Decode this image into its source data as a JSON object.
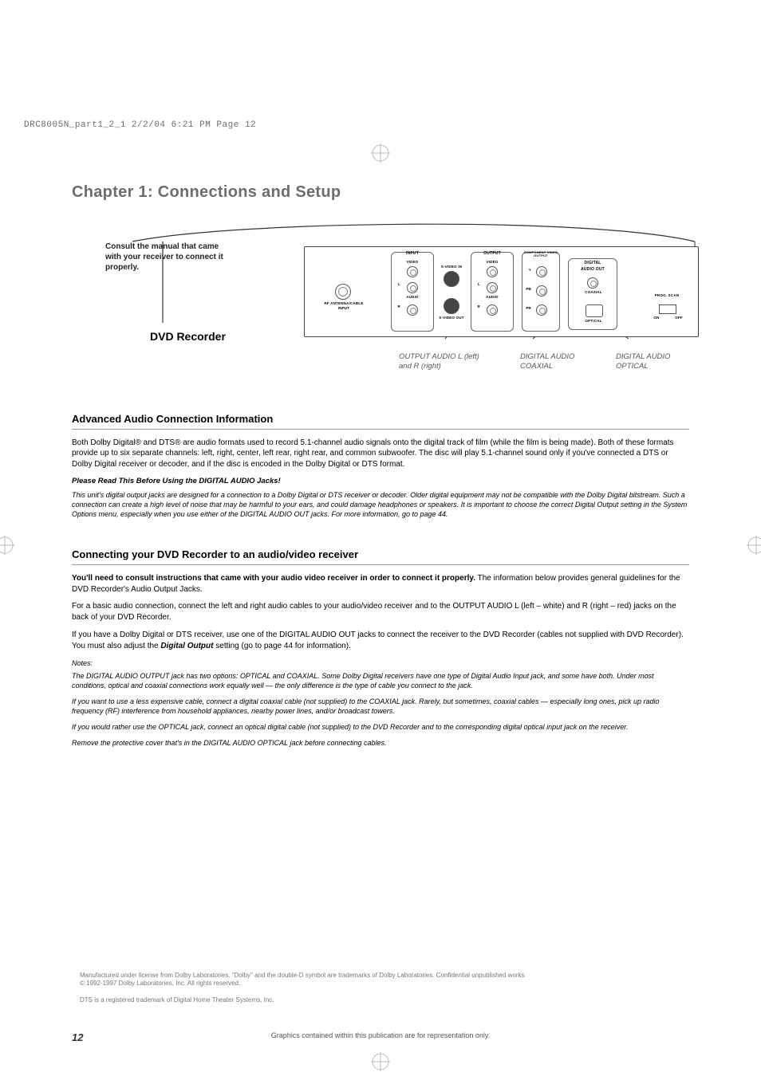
{
  "print_header": "DRC8005N_part1_2_1  2/2/04  6:21 PM  Page 12",
  "chapter_title": "Chapter 1: Connections and Setup",
  "diagram": {
    "callout": "Consult the manual that came with your receiver to connect it properly.",
    "dvd_label": "DVD Recorder",
    "panel": {
      "rf_label": "RF ANTENNA/CABLE INPUT",
      "input_box": "INPUT",
      "output_box": "OUTPUT",
      "component_box": "COMPONENT VIDEO OUTPUT",
      "digital_box_line1": "DIGITAL",
      "digital_box_line2": "AUDIO OUT",
      "video": "VIDEO",
      "svideo_in": "S-VIDEO IN",
      "svideo_out": "S-VIDEO OUT",
      "audio": "AUDIO",
      "l": "L",
      "r": "R",
      "y": "Y",
      "pb": "PB",
      "pr": "PR",
      "coaxial": "COAXIAL",
      "optical": "OPTICAL",
      "prog_scan": "PROG. SCAN",
      "switch_on": "ON",
      "switch_off": "OFF"
    },
    "caption_audio_lr_1": "OUTPUT AUDIO L (left)",
    "caption_audio_lr_2": "and R (right)",
    "caption_coax_1": "DIGITAL AUDIO",
    "caption_coax_2": "COAXIAL",
    "caption_opt_1": "DIGITAL AUDIO",
    "caption_opt_2": "OPTICAL"
  },
  "section_a": {
    "heading": "Advanced Audio Connection Information",
    "p1": "Both Dolby Digital® and DTS® are audio formats used to record 5.1-channel audio signals onto the digital track of film (while the film is being made). Both of these formats provide up to six separate channels: left, right, center, left rear, right rear, and common subwoofer. The disc will play 5.1-channel sound only if you've connected a DTS or Dolby Digital receiver or decoder, and if the disc is encoded in the Dolby Digital or DTS format.",
    "p2_bold": "Please Read This Before Using the DIGITAL AUDIO Jacks!",
    "p3_ital": "This unit's digital output jacks are designed for a connection to a Dolby Digital or DTS receiver or decoder. Older digital equipment may not be compatible with the Dolby Digital bitstream. Such a connection can create a high level of noise that may be harmful to your ears, and could damage headphones or speakers. It is important to choose the correct Digital Output setting in the System Options menu, especially when you use either of the DIGITAL AUDIO OUT jacks. For more information, go to page 44."
  },
  "section_b": {
    "heading": "Connecting your DVD Recorder to an audio/video receiver",
    "p1_lead_bold": "You'll need to consult instructions that came with your audio video receiver in order to connect it properly.",
    "p1_rest": " The information below provides general guidelines for the DVD Recorder's Audio Output Jacks.",
    "p2": "For a basic audio connection, connect the left and right audio cables to your audio/video receiver and to the OUTPUT AUDIO L (left – white) and R (right – red) jacks on the back of your DVD Recorder.",
    "p3a": "If you have a Dolby Digital or DTS receiver, use one of the DIGITAL AUDIO OUT jacks to connect the receiver to the DVD Recorder (cables not supplied with DVD Recorder). You must also adjust the ",
    "p3_bolditalic": "Digital Output",
    "p3b": " setting (go to page 44 for information).",
    "notes_label": "Notes:",
    "n1": "The DIGITAL AUDIO OUTPUT jack has two options: OPTICAL and COAXIAL. Some Dolby Digital receivers have one type of Digital Audio Input jack, and some have both. Under most conditions, optical and coaxial connections work equally well — the only difference is the type of cable you connect to the jack.",
    "n2": "If you want to use a less expensive cable, connect a digital coaxial cable (not supplied) to the COAXIAL jack. Rarely, but sometimes, coaxial cables — especially long ones, pick up radio frequency (RF) interference from household appliances, nearby power lines, and/or broadcast towers.",
    "n3": "If you would rather use the OPTICAL jack, connect an optical digital cable (not supplied) to the DVD Recorder and to the corresponding digital optical input jack on the receiver.",
    "n4": "Remove the protective cover that's in the DIGITAL AUDIO OPTICAL jack before connecting cables."
  },
  "footer": {
    "l1": "Manufactured under license from Dolby Laboratories. \"Dolby\" and the double-D symbol are trademarks of Dolby Laboratories. Confidential unpublished works.",
    "l2": "© 1992-1997 Dolby Laboratories, Inc. All rights reserved.",
    "l3": "DTS is a registered trademark of Digital Home Theater Systems, Inc.",
    "page_num": "12",
    "footer_center": "Graphics contained within this publication are for representation only."
  }
}
